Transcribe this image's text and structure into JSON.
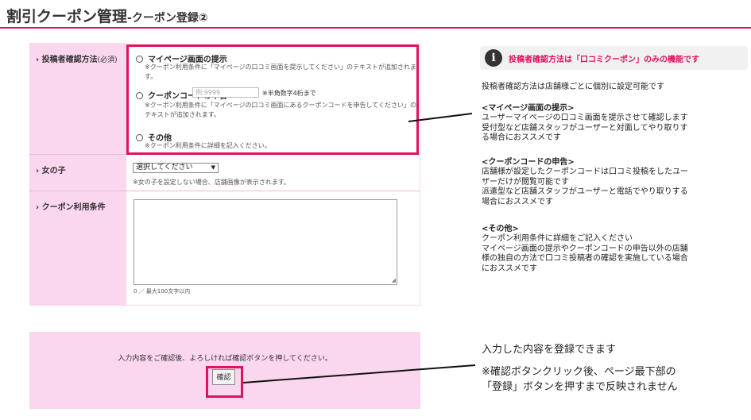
{
  "header": {
    "title": "割引クーポン管理",
    "subtitle": "-クーポン登録②"
  },
  "form": {
    "method_label": "投稿者確認方法",
    "method_required": "(必須)",
    "options": [
      {
        "label": "マイページ画面の提示",
        "note_line1": "※クーポン利用条件に「マイページの口コミ画面を提示してください」のテキストが追加されま",
        "note_line2": "す。"
      },
      {
        "label": "クーポンコードの申告",
        "placeholder": "例:9999",
        "hint": "※半角数字4桁まで",
        "note_line1": "※クーポン利用条件に「マイページの口コミ画面にあるクーポンコードを申告してください」の",
        "note_line2": "テキストが追加されます。"
      },
      {
        "label": "その他",
        "note_line1": "※クーポン利用条件に詳細を記入ください。"
      }
    ],
    "girl_label": "女の子",
    "girl_select": "選択してください",
    "girl_note": "※女の子を設定しない場合、店舗画像が表示されます。",
    "conditions_label": "クーポン利用条件",
    "counter": "0 ／ 最大100文字以内"
  },
  "confirm": {
    "instruction": "入力内容をご確認後、よろしければ確認ボタンを押してください。",
    "button_label": "確認"
  },
  "right": {
    "callout": "投稿者確認方法は「口コミクーポン」のみの機能です",
    "intro": "投稿者確認方法は店舗様ごとに個別に設定可能です",
    "sections": [
      {
        "heading": "<マイページ画面の提示>",
        "lines": [
          "ユーザーマイページの口コミ画面を提示させて確認します",
          "受付型など店舗スタッフがユーザーと対面してやり取りす",
          "る場合におススメです"
        ]
      },
      {
        "heading": "<クーポンコードの申告>",
        "lines": [
          "店舗様が設定したクーポンコードは口コミ投稿をしたユー",
          "ザーだけが閲覧可能です",
          "派遣型など店舗スタッフがユーザーと電話でやり取りする",
          "場合におススメです"
        ]
      },
      {
        "heading": "<その他>",
        "lines": [
          "クーポン利用条件に詳細をご記入ください",
          "マイページ画面の提示やクーポンコードの申告以外の店舗",
          "様の独自の方法で口コミ投稿者の確認を実施している場合",
          "におススメです"
        ]
      }
    ],
    "register_note": "入力した内容を登録できます",
    "register_warn1": "※確認ボタンクリック後、ページ最下部の",
    "register_warn2": "「登録」ボタンを押すまで反映されません"
  },
  "colors": {
    "accent": "#e0115f",
    "panel": "#fbd6ef",
    "callout_bg": "#f1f1f1"
  }
}
